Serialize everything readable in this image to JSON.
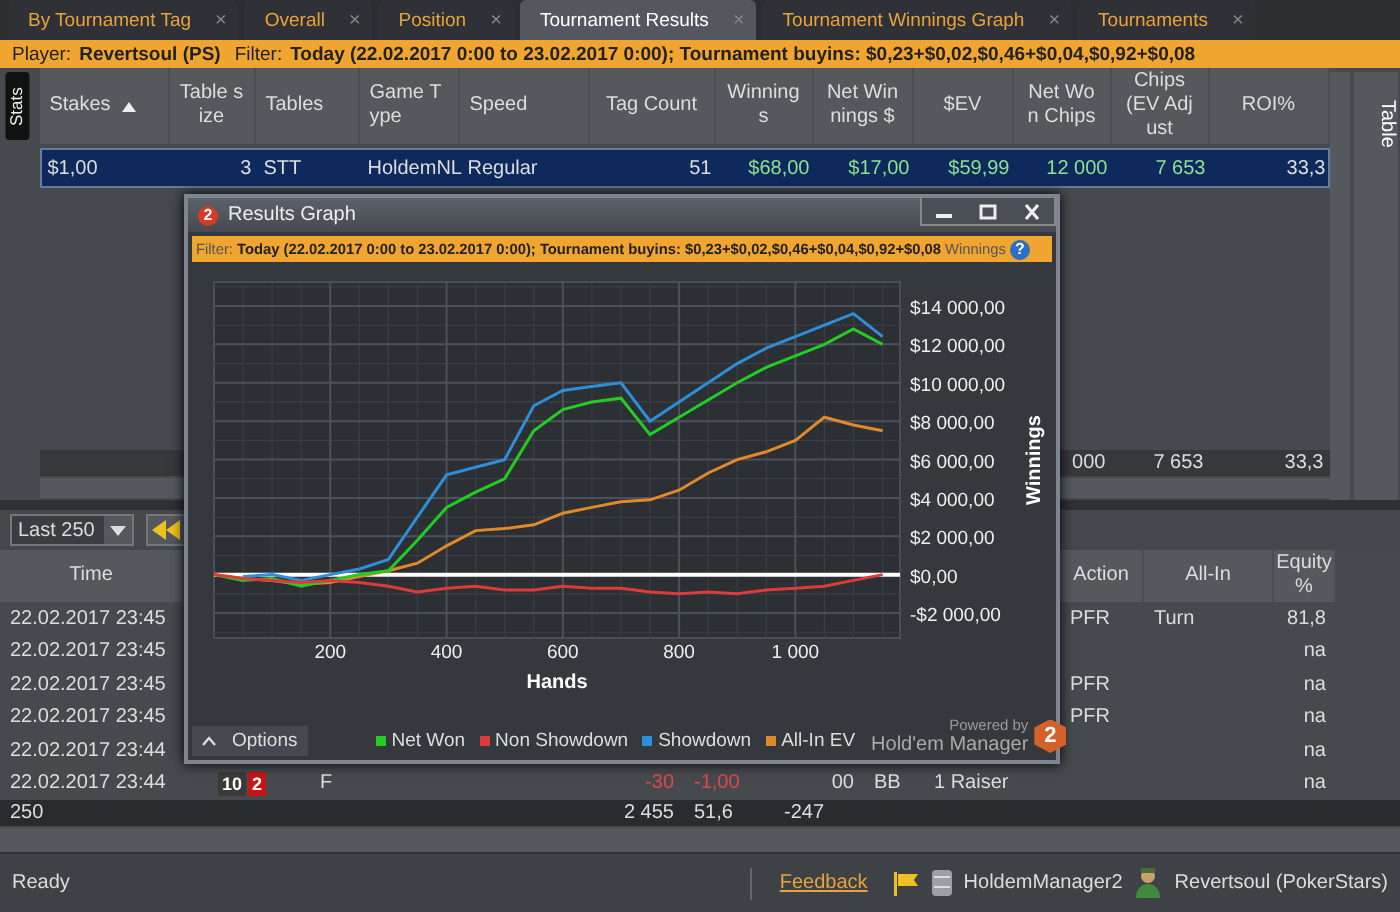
{
  "tabs": [
    {
      "label": "By Tournament Tag",
      "selected": false,
      "close": "×"
    },
    {
      "label": "Overall",
      "selected": false,
      "close": "×"
    },
    {
      "label": "Position",
      "selected": false,
      "close": "×"
    },
    {
      "label": "Tournament Results",
      "selected": true,
      "close": "×"
    },
    {
      "label": "Tournament Winnings Graph",
      "selected": false,
      "close": "×"
    },
    {
      "label": "Tournaments",
      "selected": false,
      "close": "×"
    }
  ],
  "filter_bar": {
    "player_label": "Player:",
    "player": "Revertsoul (PS)",
    "filter_label": "Filter:",
    "filter": "Today (22.02.2017 0:00 to 23.02.2017 0:00); Tournament buyins: $0,23+$0,02,$0,46+$0,04,$0,92+$0,08"
  },
  "top_table": {
    "left_tab": "Stats",
    "right_tab": "Table",
    "columns": [
      {
        "label": "Stakes",
        "sorted": true
      },
      {
        "label": "Table size",
        "sorted": false
      },
      {
        "label": "Tables",
        "sorted": false
      },
      {
        "label": "Game Type",
        "sorted": false
      },
      {
        "label": "Speed",
        "sorted": false
      },
      {
        "label": "Tag Count",
        "sorted": false
      },
      {
        "label": "Winnings",
        "sorted": false
      },
      {
        "label": "Net Winnings $",
        "sorted": false
      },
      {
        "label": "$EV",
        "sorted": false
      },
      {
        "label": "Net Won Chips",
        "sorted": false
      },
      {
        "label": "Chips (EV Adjust",
        "sorted": false
      },
      {
        "label": "ROI%",
        "sorted": false
      }
    ],
    "rows": [
      {
        "selected": true,
        "cells": [
          "$1,00",
          "3",
          "STT",
          "HoldemNL",
          "Regular",
          "51",
          "$68,00",
          "$17,00",
          "$59,99",
          "12 000",
          "7 653",
          "33,3"
        ]
      }
    ],
    "totals": {
      "net_won_chips": "000",
      "chips_ev_adjust": "7 653",
      "roi": "33,3"
    }
  },
  "bottom_toolbar": {
    "range": "Last 250"
  },
  "bottom_table": {
    "columns": {
      "time": "Time",
      "action": "Action",
      "all_in": "All-In",
      "equity": "Equity %"
    },
    "rows": [
      {
        "time": "22.02.2017 23:45",
        "action": "PFR",
        "all_in": "Turn",
        "equity": "81,8"
      },
      {
        "time": "22.02.2017 23:45",
        "equity": "na"
      },
      {
        "time": "22.02.2017 23:45",
        "action": "PFR",
        "equity": "na"
      },
      {
        "time": "22.02.2017 23:45",
        "action": "PFR",
        "equity": "na"
      },
      {
        "time": "22.02.2017 23:44",
        "equity": "na"
      },
      {
        "time": "22.02.2017 23:44",
        "cards": [
          {
            "rank": "10",
            "color": "#3a3a3a"
          },
          {
            "rank": "2",
            "color": "#c81414"
          }
        ],
        "col_3": "F",
        "col_4": "-30",
        "col_5": "-1,00",
        "col_6": "00",
        "col_7": "BB",
        "col_8": "1 Raiser",
        "equity": "na"
      }
    ],
    "totals": {
      "time": "250",
      "col_4": "2 455",
      "col_5": "51,6",
      "col_6": "-247"
    }
  },
  "status_bar": {
    "status": "Ready",
    "feedback": "Feedback",
    "database": "HoldemManager2",
    "player": "Revertsoul (PokerStars)"
  },
  "graph_window": {
    "app_badge": "2",
    "title": "Results Graph",
    "filter_label": "Filter:",
    "filter": "Today (22.02.2017 0:00 to 23.02.2017 0:00); Tournament buyins: $0,23+$0,02,$0,46+$0,04,$0,92+$0,08",
    "filter_tail": "Winnings",
    "help_glyph": "?",
    "chart_data": {
      "type": "line",
      "xlabel": "Hands",
      "ylabel": "Winnings",
      "x": [
        0,
        50,
        100,
        150,
        200,
        250,
        300,
        350,
        400,
        450,
        500,
        550,
        600,
        650,
        700,
        750,
        800,
        850,
        900,
        950,
        1000,
        1050,
        1100,
        1150
      ],
      "series": [
        {
          "name": "Net Won",
          "color": "#22cc22",
          "values": [
            0,
            -300,
            -200,
            -600,
            -300,
            0,
            200,
            1800,
            3500,
            4300,
            5000,
            7500,
            8600,
            9000,
            9200,
            7300,
            8200,
            9100,
            10000,
            10800,
            11400,
            12000,
            12800,
            12000
          ]
        },
        {
          "name": "Non Showdown",
          "color": "#dd3a3a",
          "values": [
            0,
            -200,
            -300,
            -400,
            -300,
            -400,
            -600,
            -900,
            -700,
            -600,
            -800,
            -800,
            -600,
            -700,
            -700,
            -900,
            -1000,
            -900,
            -1000,
            -800,
            -700,
            -600,
            -300,
            0
          ]
        },
        {
          "name": "Showdown",
          "color": "#2e8fd8",
          "values": [
            null,
            -100,
            0,
            -300,
            0,
            300,
            800,
            3000,
            5200,
            5600,
            6000,
            8800,
            9600,
            9800,
            10000,
            8000,
            9000,
            10000,
            11000,
            11800,
            12400,
            13000,
            13600,
            12400
          ]
        },
        {
          "name": "All-In EV",
          "color": "#e08a2a",
          "values": [
            0,
            -200,
            -300,
            -500,
            -400,
            -100,
            200,
            600,
            1500,
            2300,
            2400,
            2600,
            3200,
            3500,
            3800,
            3900,
            4400,
            5300,
            6000,
            6400,
            7000,
            8200,
            7800,
            7500
          ]
        }
      ],
      "grid": true,
      "xlim": [
        0,
        1180
      ],
      "ylim": [
        -3300,
        15250
      ],
      "xticks": [
        200,
        400,
        600,
        800,
        {
          "value": 1000,
          "label": "1 000"
        }
      ],
      "yticks": [
        {
          "value": -2000,
          "label": "-$2 000,00"
        },
        {
          "value": 0,
          "label": "$0,00"
        },
        {
          "value": 2000,
          "label": "$2 000,00"
        },
        {
          "value": 4000,
          "label": "$4 000,00"
        },
        {
          "value": 6000,
          "label": "$6 000,00"
        },
        {
          "value": 8000,
          "label": "$8 000,00"
        },
        {
          "value": 10000,
          "label": "$10 000,00"
        },
        {
          "value": 12000,
          "label": "$12 000,00"
        },
        {
          "value": 14000,
          "label": "$14 000,00"
        }
      ]
    },
    "options_button": "Options",
    "powered_by": "Powered by",
    "brand": "Hold'em Manager",
    "logo_badge": "2"
  }
}
